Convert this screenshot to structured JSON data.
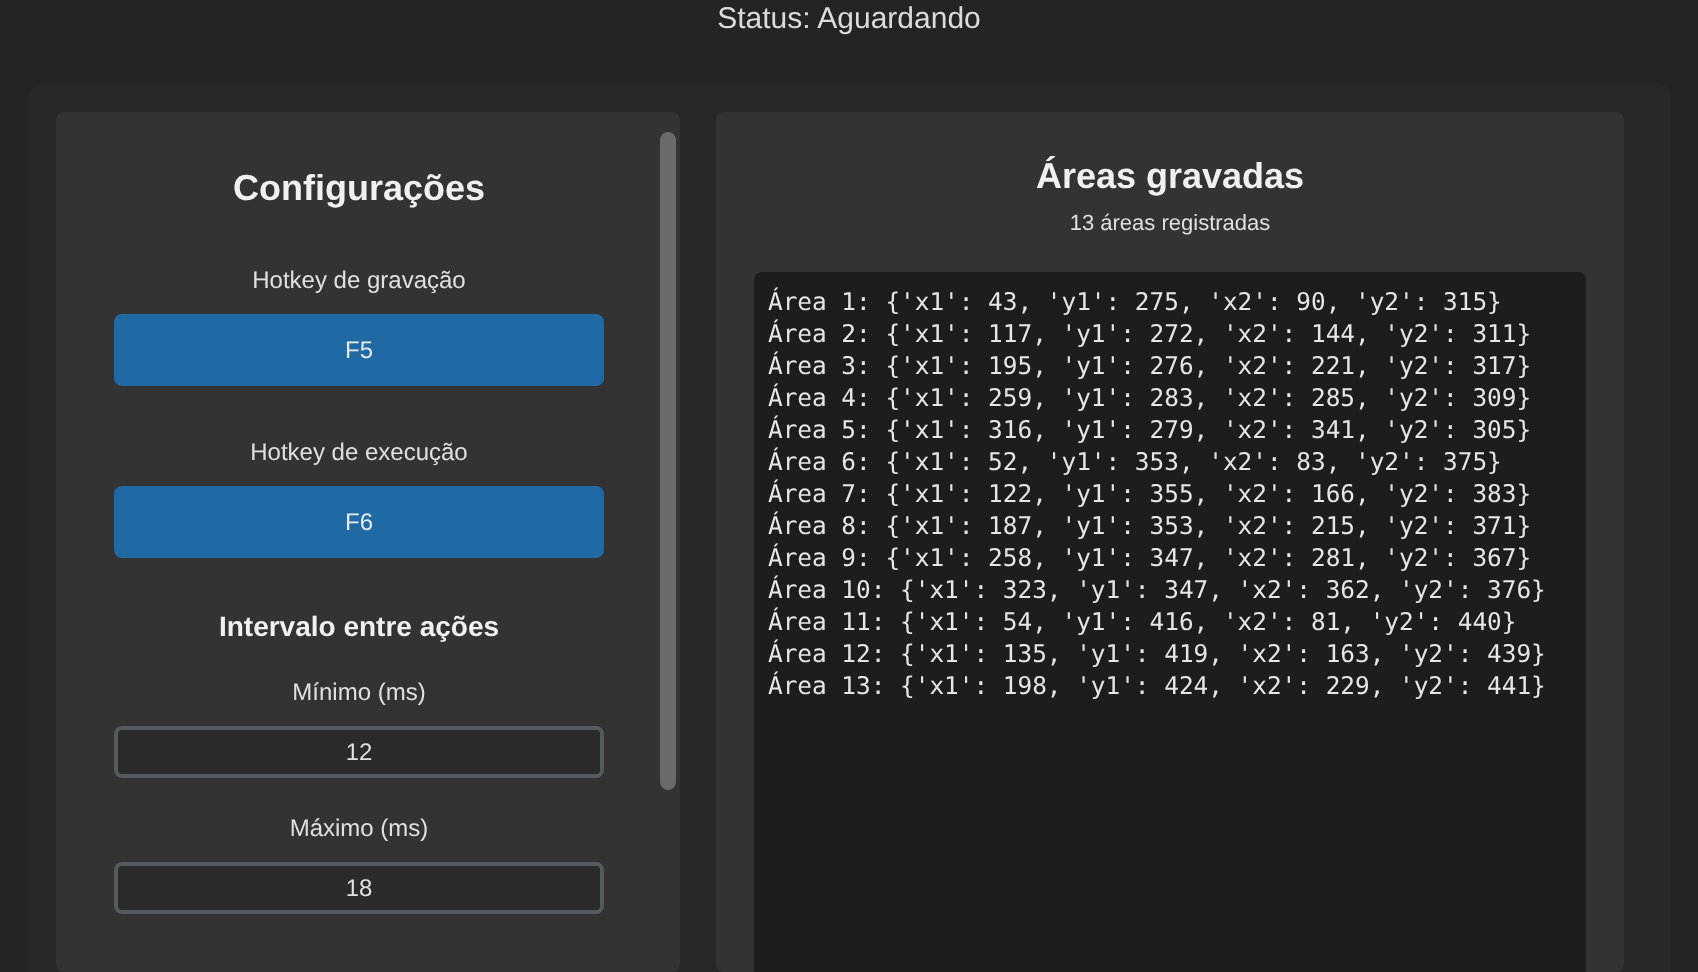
{
  "status": "Status: Aguardando",
  "settings": {
    "title": "Configurações",
    "hotkeys": [
      {
        "label": "Hotkey de gravação",
        "key": "F5"
      },
      {
        "label": "Hotkey de execução",
        "key": "F6"
      }
    ],
    "interval": {
      "title": "Intervalo entre ações",
      "fields": [
        {
          "label": "Mínimo (ms)",
          "value": "12"
        },
        {
          "label": "Máximo (ms)",
          "value": "18"
        }
      ]
    }
  },
  "areas": {
    "title": "Áreas gravadas",
    "count": "13 áreas registradas",
    "log": [
      "Área 1: {'x1': 43, 'y1': 275, 'x2': 90, 'y2': 315}",
      "Área 2: {'x1': 117, 'y1': 272, 'x2': 144, 'y2': 311}",
      "Área 3: {'x1': 195, 'y1': 276, 'x2': 221, 'y2': 317}",
      "Área 4: {'x1': 259, 'y1': 283, 'x2': 285, 'y2': 309}",
      "Área 5: {'x1': 316, 'y1': 279, 'x2': 341, 'y2': 305}",
      "Área 6: {'x1': 52, 'y1': 353, 'x2': 83, 'y2': 375}",
      "Área 7: {'x1': 122, 'y1': 355, 'x2': 166, 'y2': 383}",
      "Área 8: {'x1': 187, 'y1': 353, 'x2': 215, 'y2': 371}",
      "Área 9: {'x1': 258, 'y1': 347, 'x2': 281, 'y2': 367}",
      "Área 10: {'x1': 323, 'y1': 347, 'x2': 362, 'y2': 376}",
      "Área 11: {'x1': 54, 'y1': 416, 'x2': 81, 'y2': 440}",
      "Área 12: {'x1': 135, 'y1': 419, 'x2': 163, 'y2': 439}",
      "Área 13: {'x1': 198, 'y1': 424, 'x2': 229, 'y2': 441}"
    ]
  }
}
